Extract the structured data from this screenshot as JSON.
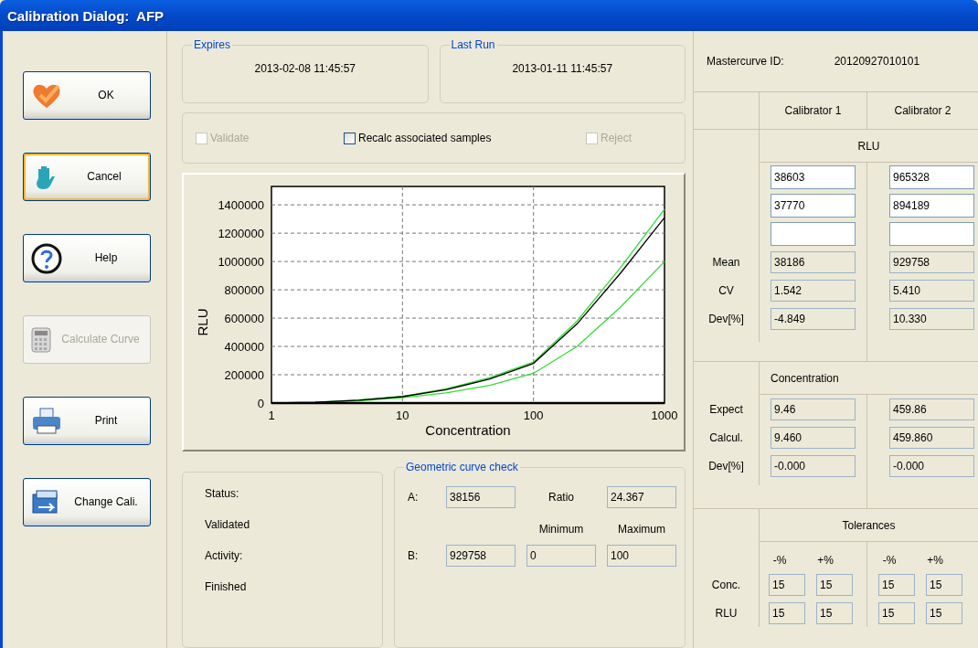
{
  "window": {
    "title": "Calibration Dialog:  AFP"
  },
  "buttons": [
    {
      "label": "OK",
      "focused": false,
      "disabled": false
    },
    {
      "label": "Cancel",
      "focused": true,
      "disabled": false
    },
    {
      "label": "Help",
      "focused": false,
      "disabled": false
    },
    {
      "label": "Calculate Curve",
      "focused": false,
      "disabled": true
    },
    {
      "label": "Print",
      "focused": false,
      "disabled": false
    },
    {
      "label": "Change Cali.",
      "focused": false,
      "disabled": false
    }
  ],
  "expires": {
    "legend": "Expires",
    "value": "2013-02-08 11:45:57"
  },
  "last_run": {
    "legend": "Last Run",
    "value": "2013-01-11 11:45:57"
  },
  "options": [
    {
      "label": "Validate",
      "checked": false,
      "disabled": true
    },
    {
      "label": "Recalc associated samples",
      "checked": false,
      "disabled": false
    },
    {
      "label": "Reject",
      "checked": false,
      "disabled": true
    }
  ],
  "chart_data": {
    "type": "line",
    "xlabel": "Concentration",
    "ylabel": "RLU",
    "categories": [
      "1",
      null,
      null,
      "10",
      null,
      null,
      "100",
      null,
      null,
      "1000"
    ],
    "series": [
      {
        "color": "#000000",
        "values": [
          0,
          5000,
          20000,
          45000,
          95000,
          170000,
          280000,
          560000,
          920000,
          1310000
        ]
      },
      {
        "color": "#33dd33",
        "values": [
          0,
          6000,
          22000,
          48000,
          100000,
          180000,
          290000,
          580000,
          960000,
          1370000
        ]
      },
      {
        "color": "#33dd33",
        "values": [
          0,
          4000,
          15000,
          38000,
          72000,
          125000,
          210000,
          400000,
          680000,
          1000000
        ]
      }
    ],
    "ylim": [
      0,
      1530000
    ],
    "grid": true,
    "yticks": [
      0,
      200000,
      400000,
      600000,
      800000,
      1000000,
      1200000,
      1400000
    ]
  },
  "status": [
    {
      "label": "Status:",
      "value": "Validated"
    },
    {
      "label": "Activity:",
      "value": "Finished"
    }
  ],
  "geometric_check": {
    "legend": "Geometric curve check",
    "a_label": "A:",
    "a_value": "38156",
    "ratio_label": "Ratio",
    "ratio_value": "24.367",
    "minimum_label": "Minimum",
    "maximum_label": "Maximum",
    "b_label": "B:",
    "b_value": "929758",
    "minimum_value": "0",
    "maximum_value": "100"
  },
  "mastercurve": {
    "label": "Mastercurve ID:",
    "value": "20120927010101"
  },
  "calibrators": [
    "Calibrator 1",
    "Calibrator 2"
  ],
  "rlu": {
    "title": "RLU",
    "rows": [
      {
        "kind": "input",
        "values": [
          "38603",
          "965328"
        ]
      },
      {
        "kind": "input",
        "values": [
          "37770",
          "894189"
        ]
      },
      {
        "kind": "empty"
      },
      {
        "kind": "readonly",
        "label": "Mean",
        "values": [
          "38186",
          "929758"
        ]
      },
      {
        "kind": "readonly",
        "label": "CV",
        "values": [
          "1.542",
          "5.410"
        ]
      },
      {
        "kind": "readonly",
        "label": "Dev[%]",
        "values": [
          "-4.849",
          "10.330"
        ]
      }
    ]
  },
  "concentration": {
    "title": "Concentration",
    "rows": [
      {
        "kind": "readonly",
        "label": "Expect",
        "values": [
          "9.46",
          "459.86"
        ]
      },
      {
        "kind": "readonly",
        "label": "Calcul.",
        "values": [
          "9.460",
          "459.860"
        ]
      },
      {
        "kind": "readonly",
        "label": "Dev[%]",
        "values": [
          "-0.000",
          "-0.000"
        ]
      }
    ]
  },
  "tolerances": {
    "title": "Tolerances",
    "headers": [
      "-%",
      "+%",
      "-%",
      "+%"
    ],
    "rows": [
      {
        "label": "Conc.",
        "values": [
          "15",
          "15",
          "15",
          "15"
        ]
      },
      {
        "label": "RLU",
        "values": [
          "15",
          "15",
          "15",
          "15"
        ]
      }
    ]
  }
}
